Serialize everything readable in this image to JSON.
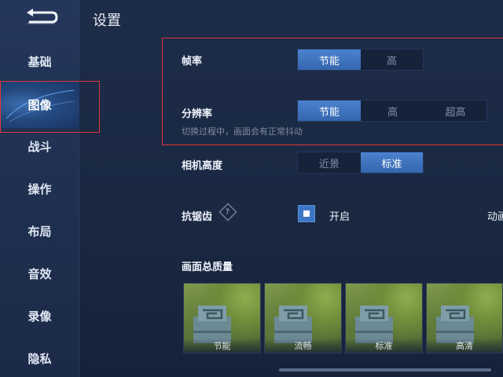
{
  "header": {
    "title": "设置"
  },
  "sidebar": {
    "items": [
      {
        "label": "基础"
      },
      {
        "label": "图像"
      },
      {
        "label": "战斗"
      },
      {
        "label": "操作"
      },
      {
        "label": "布局"
      },
      {
        "label": "音效"
      },
      {
        "label": "录像"
      },
      {
        "label": "隐私"
      }
    ],
    "active": "图像"
  },
  "settings": {
    "frame_rate": {
      "label": "帧率",
      "options": [
        "节能",
        "高"
      ],
      "selected": "节能"
    },
    "resolution": {
      "label": "分辨率",
      "options": [
        "节能",
        "高",
        "超高"
      ],
      "selected": "节能",
      "hint": "切换过程中，画面会有正常抖动"
    },
    "camera_height": {
      "label": "相机高度",
      "options": [
        "近景",
        "标准"
      ],
      "selected": "标准"
    },
    "anti_aliasing": {
      "label": "抗锯齿",
      "help": "?",
      "toggle_label": "开启",
      "checked": true,
      "truncated_label": "动画"
    },
    "overall_quality": {
      "label": "画面总质量",
      "thumbnails": [
        "节能",
        "流畅",
        "标准",
        "高清"
      ]
    }
  },
  "colors": {
    "accent": "#3e76c4",
    "highlight_box": "#e0363a",
    "background": "#1a2842"
  }
}
